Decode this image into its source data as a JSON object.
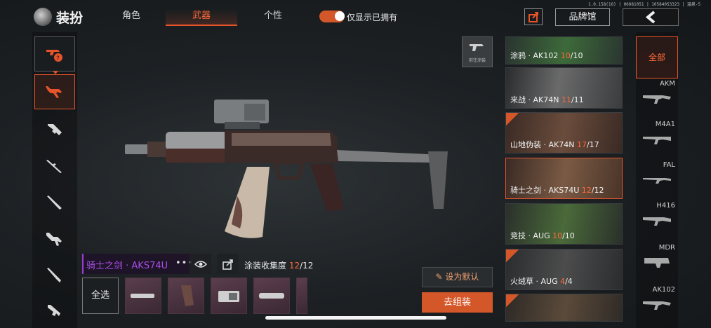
{
  "header": {
    "title": "装扮",
    "tabs": [
      "角色",
      "武器",
      "个性"
    ],
    "active_tab": "武器",
    "toggle_label": "仅显示已拥有",
    "toggle_on": true,
    "version": "1.0.158(16) | 06081051 | 10584053323 | 温泉-5",
    "brand_button": "品牌馆"
  },
  "left_categories": [
    "shuffle-icon",
    "rifle-icon",
    "smg-icon",
    "sniper-icon",
    "shotgun-icon",
    "lmg-icon",
    "dmr-icon",
    "pistol-icon"
  ],
  "pre_paint_label": "前往涂装",
  "selected_skin": {
    "name": "骑士之剑 · AKS74U",
    "more": "•••",
    "collect_label": "涂装收集度 ",
    "collect_owned": "12",
    "collect_total": "/12"
  },
  "select_all_label": "全选",
  "actions": {
    "set_default": "设为默认",
    "go_assemble": "去组装"
  },
  "skins": [
    {
      "name": "涂鸦 · AK102 ",
      "owned": "10",
      "total": "/10",
      "tag": false,
      "selected": false,
      "color": "#3d6a3a"
    },
    {
      "name": "来战 · AK74N ",
      "owned": "11",
      "total": "/11",
      "tag": false,
      "selected": false,
      "color": "#6a6a6a"
    },
    {
      "name": "山地伪装 · AK74N ",
      "owned": "17",
      "total": "/17",
      "tag": true,
      "selected": false,
      "color": "#6a4c3c"
    },
    {
      "name": "骑士之剑 · AKS74U ",
      "owned": "12",
      "total": "/12",
      "tag": false,
      "selected": true,
      "color": "#7a5a44"
    },
    {
      "name": "竞技 · AUG ",
      "owned": "10",
      "total": "/10",
      "tag": false,
      "selected": false,
      "color": "#4a6a3a"
    },
    {
      "name": "火绒草 · AUG ",
      "owned": "4",
      "total": "/4",
      "tag": true,
      "selected": false,
      "color": "#4c4c4c"
    },
    {
      "name": "",
      "owned": "",
      "total": "",
      "tag": true,
      "selected": false,
      "color": "#5a4a3a"
    }
  ],
  "weapon_types": {
    "all": "全部",
    "items": [
      "AKM",
      "M4A1",
      "FAL",
      "H416",
      "MDR",
      "AK102"
    ]
  },
  "colors": {
    "accent": "#e8542a",
    "rare_purple": "#a94ee8"
  }
}
